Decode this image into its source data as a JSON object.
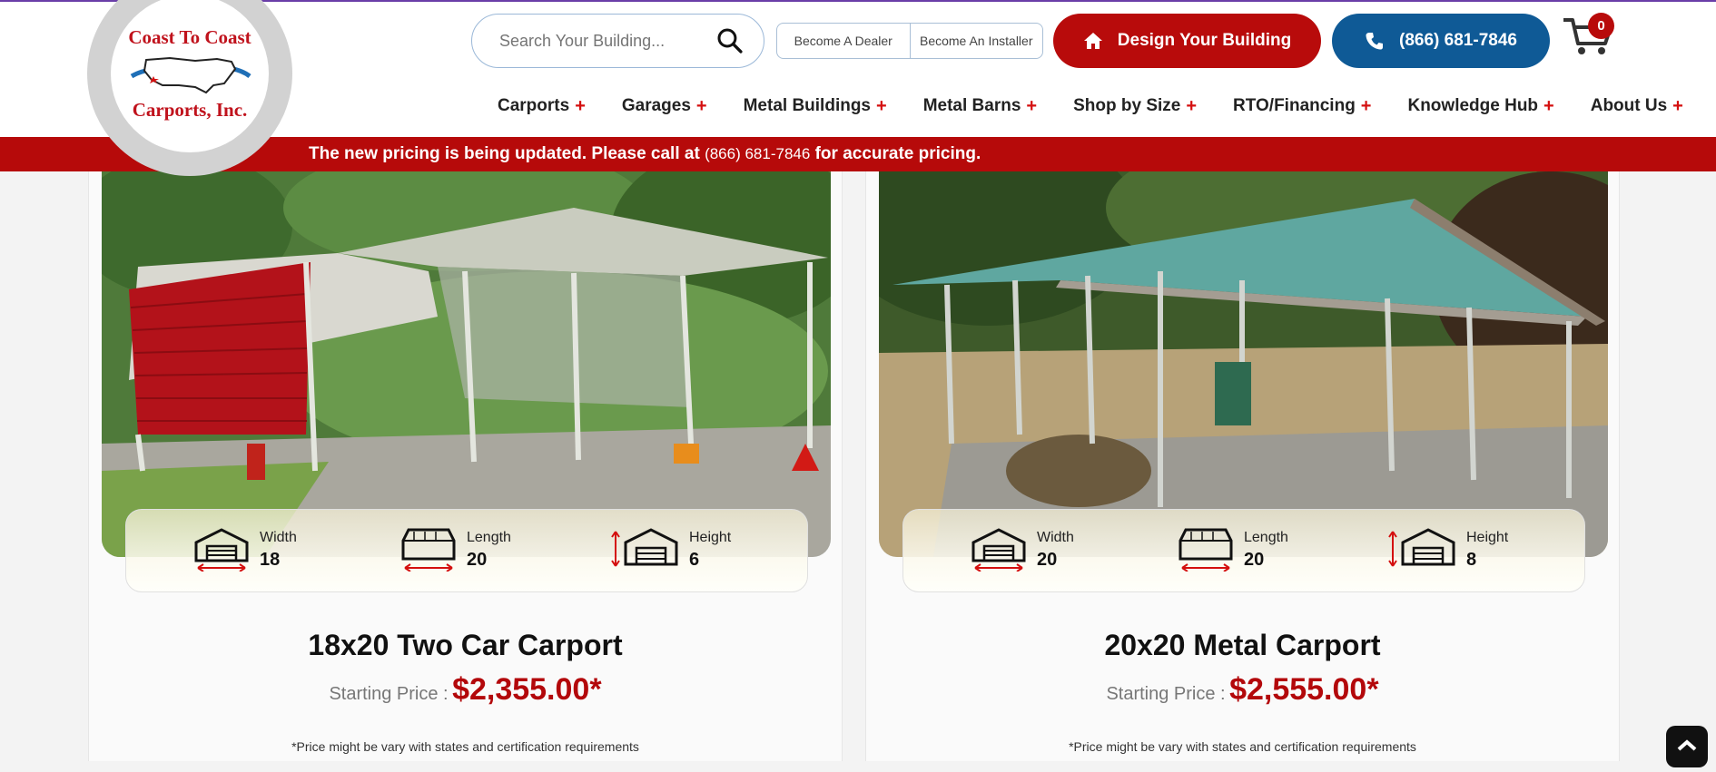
{
  "logo": {
    "line1": "Coast To Coast",
    "line2": "Carports, Inc."
  },
  "search": {
    "placeholder": "Search Your Building..."
  },
  "header": {
    "dealer_label": "Become A Dealer",
    "installer_label": "Become An Installer",
    "design_label": "Design Your Building",
    "phone_label": "(866) 681-7846",
    "cart_count": "0"
  },
  "nav": [
    {
      "label": "Carports"
    },
    {
      "label": "Garages"
    },
    {
      "label": "Metal Buildings"
    },
    {
      "label": "Metal Barns"
    },
    {
      "label": "Shop by Size"
    },
    {
      "label": "RTO/Financing"
    },
    {
      "label": "Knowledge Hub"
    },
    {
      "label": "About Us"
    }
  ],
  "banner": {
    "before": "The new pricing is being updated. Please call at ",
    "phone": "(866) 681-7846",
    "after": " for accurate pricing."
  },
  "products": [
    {
      "title": "18x20 Two Car Carport",
      "price_label": "Starting Price :",
      "price": "$2,355.00*",
      "width_label": "Width",
      "width": "18",
      "length_label": "Length",
      "length": "20",
      "height_label": "Height",
      "height": "6",
      "note": "*Price might be vary with states and certification requirements"
    },
    {
      "title": "20x20 Metal Carport",
      "price_label": "Starting Price :",
      "price": "$2,555.00*",
      "width_label": "Width",
      "width": "20",
      "length_label": "Length",
      "length": "20",
      "height_label": "Height",
      "height": "8",
      "note": "*Price might be vary with states and certification requirements"
    }
  ],
  "colors": {
    "brand_red": "#b80b0b",
    "brand_blue": "#0f5a96",
    "banner_red": "#b60a0a"
  }
}
